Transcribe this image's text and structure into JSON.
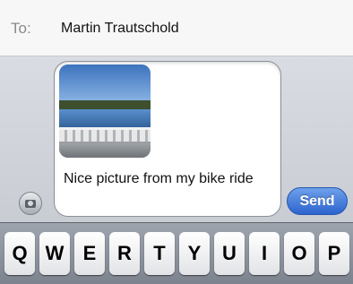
{
  "header": {
    "to_label": "To:",
    "recipient": "Martin Trautschold"
  },
  "compose": {
    "attachment_icon": "camera-icon",
    "message_text": "Nice picture from my bike ride",
    "send_label": "Send",
    "accent_color": "#2c64cf"
  },
  "keyboard": {
    "keys": [
      "Q",
      "W",
      "E",
      "R",
      "T",
      "Y",
      "U",
      "I",
      "O",
      "P"
    ]
  }
}
